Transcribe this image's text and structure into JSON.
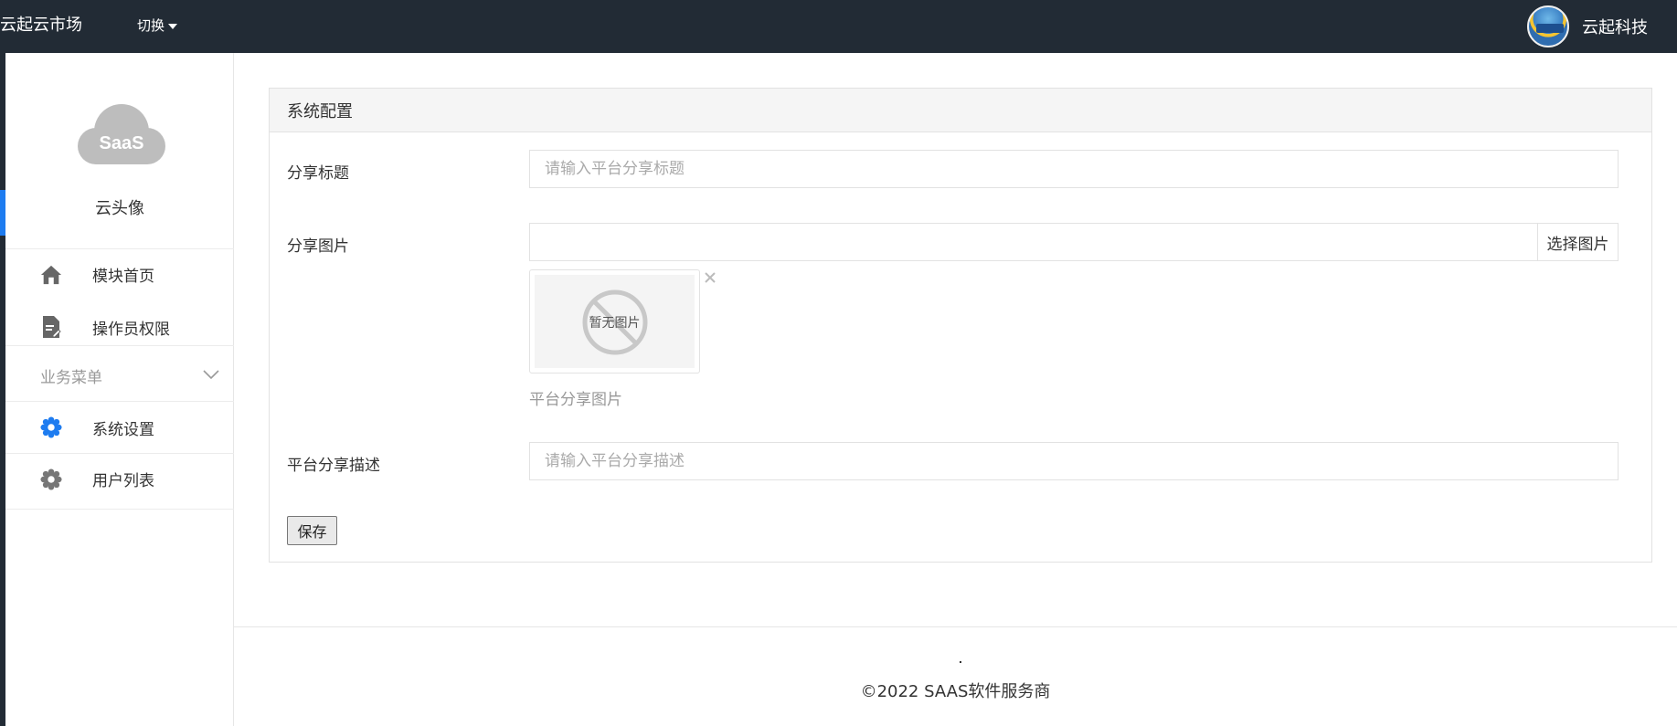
{
  "topbar": {
    "brand": "云起云市场",
    "switch_label": "切换",
    "user_name": "云起科技"
  },
  "sidebar": {
    "logo_text": "SaaS",
    "profile_name": "云头像",
    "items": [
      {
        "label": "模块首页",
        "icon": "home-icon"
      },
      {
        "label": "操作员权限",
        "icon": "document-edit-icon"
      }
    ],
    "group": {
      "label": "业务菜单",
      "icon": "chevron-down-icon"
    },
    "group_items": [
      {
        "label": "系统设置",
        "icon": "gear-icon",
        "active": true
      },
      {
        "label": "用户列表",
        "icon": "gear-icon",
        "active": false
      }
    ]
  },
  "panel": {
    "title": "系统配置",
    "share_title": {
      "label": "分享标题",
      "value": "",
      "placeholder": "请输入平台分享标题"
    },
    "share_image": {
      "label": "分享图片",
      "value": "",
      "button": "选择图片",
      "placeholder_image_text": "暂无图片",
      "hint": "平台分享图片"
    },
    "share_desc": {
      "label": "平台分享描述",
      "value": "",
      "placeholder": "请输入平台分享描述"
    },
    "save_label": "保存"
  },
  "footer": {
    "dot": ".",
    "copyright": "©2022 SAAS软件服务商"
  },
  "colors": {
    "topbar": "#222b35",
    "accent": "#1e7cf0",
    "muted_text": "#999999"
  }
}
